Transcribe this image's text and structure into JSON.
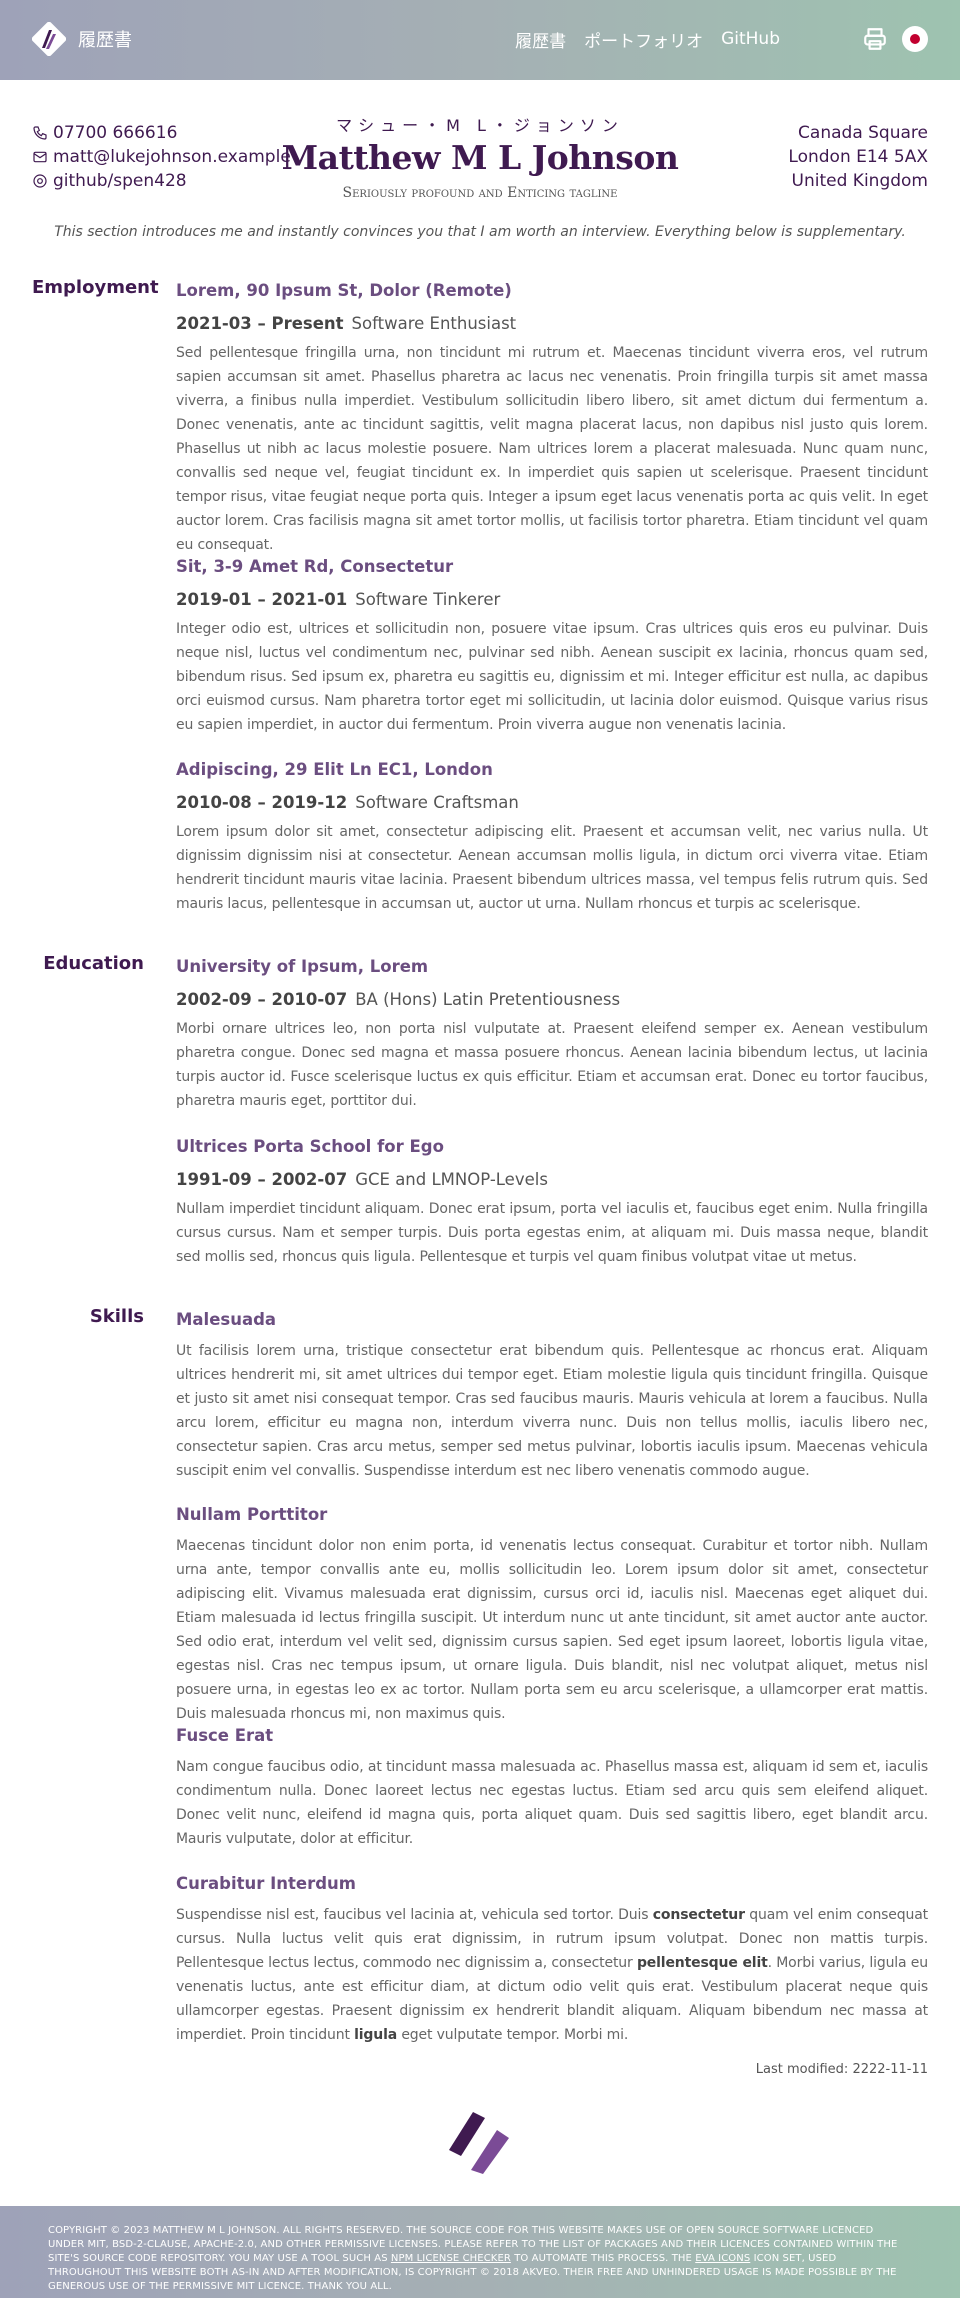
{
  "header": {
    "brand_title": "履歴書",
    "nav": [
      "履歴書",
      "ポートフォリオ",
      "GitHub"
    ],
    "printer_icon": "printer-icon",
    "language_icon": "japan-flag-icon"
  },
  "contact": {
    "phone": "07700 666616",
    "email": "matt@lukejohnson.example",
    "github": "github/spen428",
    "furigana": "マシュー・M L・ジョンソン",
    "name": "Matthew M L Johnson",
    "tagline": "Seriously profound and Enticing tagline",
    "address": [
      "Canada Square",
      "London E14 5AX",
      "United Kingdom"
    ]
  },
  "intro": "This section introduces me and instantly convinces you that I am worth an interview. Everything below is supplementary.",
  "employment": {
    "heading": "Employment",
    "entries": [
      {
        "title": "Lorem, 90 Ipsum St, Dolor (Remote)",
        "dates": "2021-03 – Present",
        "role": "Software Enthusiast",
        "text": "Sed pellentesque fringilla urna, non tincidunt mi rutrum et. Maecenas tincidunt viverra eros, vel rutrum sapien accumsan sit amet. Phasellus pharetra ac lacus nec venenatis. Proin fringilla turpis sit amet massa viverra, a finibus nulla imperdiet. Vestibulum sollicitudin libero libero, sit amet dictum dui fermentum a. Donec venenatis, ante ac tincidunt sagittis, velit magna placerat lacus, non dapibus nisl justo quis lorem. Phasellus ut nibh ac lacus molestie posuere. Nam ultrices lorem a placerat malesuada. Nunc quam nunc, convallis sed neque vel, feugiat tincidunt ex. In imperdiet quis sapien ut scelerisque. Praesent tincidunt tempor risus, vitae feugiat neque porta quis. Integer a ipsum eget lacus venenatis porta ac quis velit. In eget auctor lorem. Cras facilisis magna sit amet tortor mollis, ut facilisis tortor pharetra. Etiam tincidunt vel quam eu consequat."
      },
      {
        "title": "Sit, 3-9 Amet Rd, Consectetur",
        "dates": "2019-01 – 2021-01",
        "role": "Software Tinkerer",
        "text": "Integer odio est, ultrices et sollicitudin non, posuere vitae ipsum. Cras ultrices quis eros eu pulvinar. Duis neque nisl, luctus vel condimentum nec, pulvinar sed nibh. Aenean suscipit ex lacinia, rhoncus quam sed, bibendum risus. Sed ipsum ex, pharetra eu sagittis eu, dignissim et mi. Integer efficitur est nulla, ac dapibus orci euismod cursus. Nam pharetra tortor eget mi sollicitudin, ut lacinia dolor euismod. Quisque varius risus eu sapien imperdiet, in auctor dui fermentum. Proin viverra augue non venenatis lacinia."
      },
      {
        "title": "Adipiscing, 29 Elit Ln EC1, London",
        "dates": "2010-08 – 2019-12",
        "role": "Software Craftsman",
        "text": "Lorem ipsum dolor sit amet, consectetur adipiscing elit. Praesent et accumsan velit, nec varius nulla. Ut dignissim dignissim nisi at consectetur. Aenean accumsan mollis ligula, in dictum orci viverra vitae. Etiam hendrerit tincidunt mauris vitae lacinia. Praesent bibendum ultrices massa, vel tempus felis rutrum quis. Sed mauris lacus, pellentesque in accumsan ut, auctor ut urna. Nullam rhoncus et turpis ac scelerisque."
      }
    ]
  },
  "education": {
    "heading": "Education",
    "entries": [
      {
        "title": "University of Ipsum, Lorem",
        "dates": "2002-09 – 2010-07",
        "role": "BA (Hons) Latin Pretentiousness",
        "text": "Morbi ornare ultrices leo, non porta nisl vulputate at. Praesent eleifend semper ex. Aenean vestibulum pharetra congue. Donec sed magna et massa posuere rhoncus. Aenean lacinia bibendum lectus, ut lacinia turpis auctor id. Fusce scelerisque luctus ex quis efficitur. Etiam et accumsan erat. Donec eu tortor faucibus, pharetra mauris eget, porttitor dui."
      },
      {
        "title": "Ultrices Porta School for Ego",
        "dates": "1991-09 – 2002-07",
        "role": "GCE and LMNOP-Levels",
        "text": "Nullam imperdiet tincidunt aliquam. Donec erat ipsum, porta vel iaculis et, faucibus eget enim. Nulla fringilla cursus cursus. Nam et semper turpis. Duis porta egestas enim, at aliquam mi. Duis massa neque, blandit sed mollis sed, rhoncus quis ligula. Pellentesque et turpis vel quam finibus volutpat vitae ut metus."
      }
    ]
  },
  "skills": {
    "heading": "Skills",
    "entries": [
      {
        "title": "Malesuada",
        "text": "Ut facilisis lorem urna, tristique consectetur erat bibendum quis. Pellentesque ac rhoncus erat. Aliquam ultrices hendrerit mi, sit amet ultrices dui tempor eget. Etiam molestie ligula quis tincidunt fringilla. Quisque et justo sit amet nisi consequat tempor. Cras sed faucibus mauris. Mauris vehicula at lorem a faucibus. Nulla arcu lorem, efficitur eu magna non, interdum viverra nunc. Duis non tellus mollis, iaculis libero nec, consectetur sapien. Cras arcu metus, semper sed metus pulvinar, lobortis iaculis ipsum. Maecenas vehicula suscipit enim vel convallis. Suspendisse interdum est nec libero venenatis commodo augue."
      },
      {
        "title": "Nullam Porttitor",
        "text": "Maecenas tincidunt dolor non enim porta, id venenatis lectus consequat. Curabitur et tortor nibh. Nullam urna ante, tempor convallis ante eu, mollis sollicitudin leo. Lorem ipsum dolor sit amet, consectetur adipiscing elit. Vivamus malesuada erat dignissim, cursus orci id, iaculis nisl. Maecenas eget aliquet dui. Etiam malesuada id lectus fringilla suscipit. Ut interdum nunc ut ante tincidunt, sit amet auctor ante auctor. Sed odio erat, interdum vel velit sed, dignissim cursus sapien. Sed eget ipsum laoreet, lobortis ligula vitae, egestas nisl. Cras nec tempus ipsum, ut ornare ligula. Duis blandit, nisl nec volutpat aliquet, metus nisl posuere urna, in egestas leo ex ac tortor. Nullam porta sem eu arcu scelerisque, a ullamcorper erat mattis. Duis malesuada rhoncus mi, non maximus quis."
      },
      {
        "title": "Fusce Erat",
        "text": "Nam congue faucibus odio, at tincidunt massa malesuada ac. Phasellus massa est, aliquam id sem et, iaculis condimentum nulla. Donec laoreet lectus nec egestas luctus. Etiam sed arcu quis sem eleifend aliquet. Donec velit nunc, eleifend id magna quis, porta aliquet quam. Duis sed sagittis libero, eget blandit arcu. Mauris vulputate, dolor at efficitur."
      },
      {
        "title": "Curabitur Interdum",
        "text_parts": [
          "Suspendisse nisl est, faucibus vel lacinia at, vehicula sed tortor. Duis ",
          "consectetur",
          " quam vel enim consequat cursus. Nulla luctus velit quis erat dignissim, in rutrum ipsum volutpat. Donec non mattis turpis. Pellentesque lectus lectus, commodo nec dignissim a, consectetur ",
          "pellentesque elit",
          ". Morbi varius, ligula eu venenatis luctus, ante est efficitur diam, at dictum odio velit quis erat. Vestibulum placerat neque quis ullamcorper egestas. Praesent dignissim ex hendrerit blandit aliquam. Aliquam bibendum nec massa at imperdiet. Proin tincidunt ",
          "ligula",
          " eget vulputate tempor. Morbi mi."
        ]
      }
    ]
  },
  "last_modified": "Last modified: 2222-11-11",
  "footer": {
    "p1": "Copyright © 2023 Matthew M L Johnson. All rights reserved. The source code for this website makes use of open source software licenced under MIT, BSD-2-Clause, Apache-2.0, and other permissive licenses. Please refer to the list of packages and their licences contained within the site's source code repository. You may use a tool such as ",
    "link1": "npm license checker",
    "p2": " to automate this process. The ",
    "link2": "Eva Icons",
    "p3": " icon set, used throughout this website both as-in and after modification, is Copyright © 2018 Akveo. Their free and unhindered usage is made possible by the generous use of the permissive MIT licence. Thank you all."
  },
  "colors": {
    "accent": "#3f1a50",
    "entry_title": "#6b4e80",
    "header_gradient_left": "#9ea2b8",
    "header_gradient_right": "#9ec3b0"
  }
}
